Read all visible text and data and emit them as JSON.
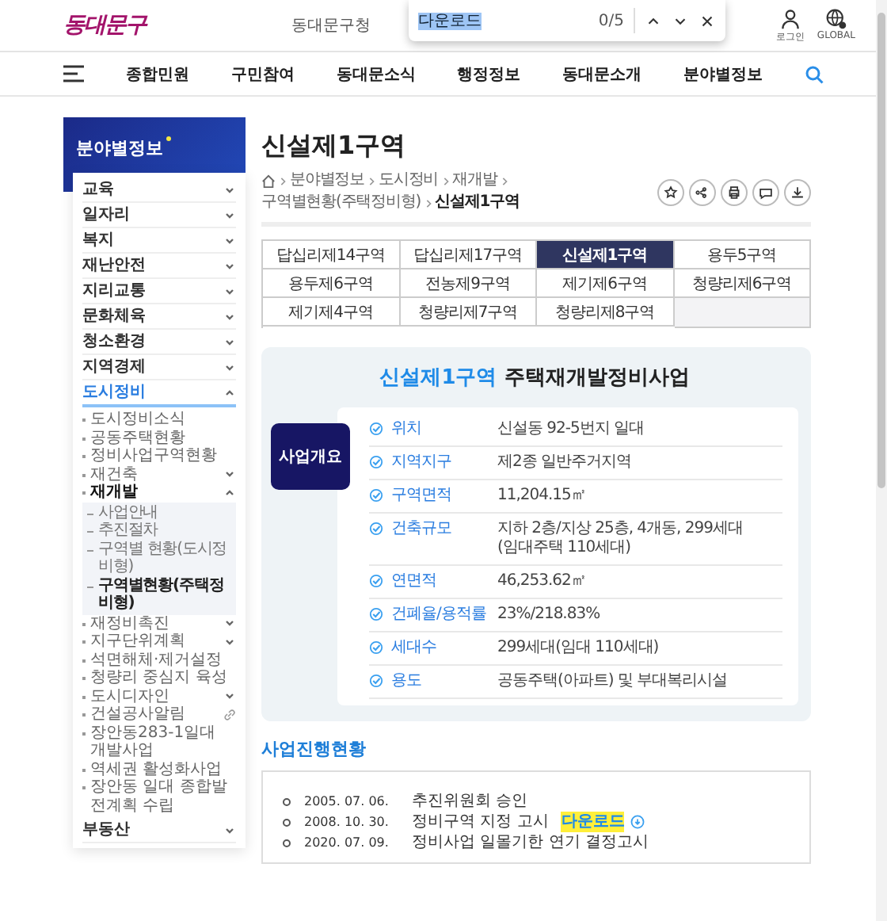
{
  "header": {
    "logo": "동대문구",
    "office_link": "동대문구청",
    "login": "로그인",
    "global": "GLOBAL"
  },
  "find_bar": {
    "value": "다운로드",
    "count": "0/5"
  },
  "nav": {
    "items": [
      "종합민원",
      "구민참여",
      "동대문소식",
      "행정정보",
      "동대문소개",
      "분야별정보"
    ]
  },
  "sidebar": {
    "title": "분야별정보",
    "items": [
      {
        "label": "교육",
        "expanded": false,
        "selected": false
      },
      {
        "label": "일자리",
        "expanded": false,
        "selected": false
      },
      {
        "label": "복지",
        "expanded": false,
        "selected": false
      },
      {
        "label": "재난안전",
        "expanded": false,
        "selected": false
      },
      {
        "label": "지리교통",
        "expanded": false,
        "selected": false
      },
      {
        "label": "문화체육",
        "expanded": false,
        "selected": false
      },
      {
        "label": "청소환경",
        "expanded": false,
        "selected": false
      },
      {
        "label": "지역경제",
        "expanded": false,
        "selected": false
      },
      {
        "label": "도시정비",
        "expanded": true,
        "selected": true,
        "children": [
          {
            "label": "도시정비소식",
            "selected": false
          },
          {
            "label": "공동주택현황",
            "selected": false
          },
          {
            "label": "정비사업구역현황",
            "selected": false
          },
          {
            "label": "재건축",
            "expanded": false,
            "selected": false
          },
          {
            "label": "재개발",
            "expanded": true,
            "selected": true,
            "children": [
              {
                "label": "사업안내",
                "selected": false
              },
              {
                "label": "추진절차",
                "selected": false
              },
              {
                "label": "구역별 현황(도시정비형)",
                "selected": false
              },
              {
                "label": "구역별현황(주택정비형)",
                "selected": true
              }
            ]
          },
          {
            "label": "재정비촉진",
            "expanded": false,
            "selected": false
          },
          {
            "label": "지구단위계획",
            "expanded": false,
            "selected": false
          },
          {
            "label": "석면해체·제거설정",
            "selected": false
          },
          {
            "label": "청량리 중심지 육성",
            "selected": false
          },
          {
            "label": "도시디자인",
            "expanded": false,
            "selected": false
          },
          {
            "label": "건설공사알림",
            "external": true,
            "selected": false
          },
          {
            "label": "장안동283-1일대 개발사업",
            "selected": false
          },
          {
            "label": "역세권 활성화사업",
            "selected": false
          },
          {
            "label": "장안동 일대 종합발전계획 수립",
            "selected": false
          }
        ]
      },
      {
        "label": "부동산",
        "expanded": false,
        "selected": false
      }
    ]
  },
  "page_title": "신설제1구역",
  "breadcrumb": [
    "분야별정보",
    "도시정비",
    "재개발",
    "구역별현황(주택정비형)",
    "신설제1구역"
  ],
  "tabs": [
    {
      "label": "답십리제14구역",
      "selected": false
    },
    {
      "label": "답십리제17구역",
      "selected": false
    },
    {
      "label": "신설제1구역",
      "selected": true
    },
    {
      "label": "용두5구역",
      "selected": false
    },
    {
      "label": "용두제6구역",
      "selected": false
    },
    {
      "label": "전농제9구역",
      "selected": false
    },
    {
      "label": "제기제6구역",
      "selected": false
    },
    {
      "label": "청량리제6구역",
      "selected": false
    },
    {
      "label": "제기제4구역",
      "selected": false
    },
    {
      "label": "청량리제7구역",
      "selected": false
    },
    {
      "label": "청량리제8구역",
      "selected": false
    }
  ],
  "overview": {
    "title_highlight": "신설제1구역",
    "title_rest": "주택재개발정비사업",
    "badge": "사업개요",
    "rows": [
      {
        "label": "위치",
        "value": [
          "신설동 92-5번지 일대"
        ]
      },
      {
        "label": "지역지구",
        "value": [
          "제2종 일반주거지역"
        ]
      },
      {
        "label": "구역면적",
        "value": [
          "11,204.15㎡"
        ]
      },
      {
        "label": "건축규모",
        "value": [
          "지하 2층/지상 25층, 4개동, 299세대",
          "(임대주택 110세대)"
        ]
      },
      {
        "label": "연면적",
        "value": [
          "46,253.62㎡"
        ]
      },
      {
        "label": "건폐율/용적률",
        "value": [
          "23%/218.83%"
        ]
      },
      {
        "label": "세대수",
        "value": [
          "299세대(임대 110세대)"
        ]
      },
      {
        "label": "용도",
        "value": [
          "공동주택(아파트) 및 부대복리시설"
        ]
      }
    ]
  },
  "progress": {
    "title": "사업진행현황",
    "entries": [
      {
        "date": "2005. 07. 06.",
        "text": "추진위원회 승인"
      },
      {
        "date": "2008. 10. 30.",
        "text": "정비구역 지정 고시",
        "download": "다운로드",
        "highlighted": true
      },
      {
        "date": "2020. 07. 09.",
        "text": "정비사업 일몰기한 연기 결정고시"
      }
    ]
  }
}
